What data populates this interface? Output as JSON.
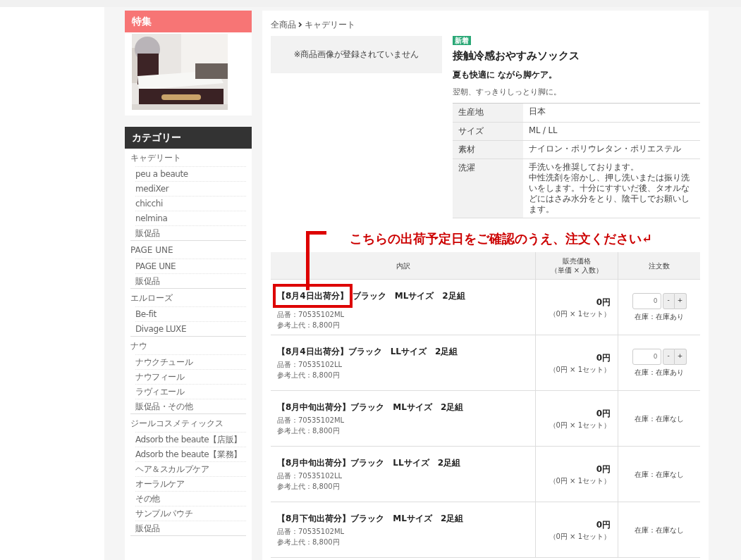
{
  "sidebar": {
    "feature": {
      "title": "特集"
    },
    "categories": {
      "title": "カテゴリー",
      "groups": [
        {
          "label": "キャデリート",
          "children": [
            {
              "label": "peu a beaute"
            },
            {
              "label": "mediXer"
            },
            {
              "label": "chicchi"
            },
            {
              "label": "nelmina"
            },
            {
              "label": "販促品"
            }
          ]
        },
        {
          "label": "PAGE UNE",
          "children": [
            {
              "label": "PAGE UNE"
            },
            {
              "label": "販促品"
            }
          ]
        },
        {
          "label": "エルローズ",
          "children": [
            {
              "label": "Be-fit"
            },
            {
              "label": "Divage LUXE"
            }
          ]
        },
        {
          "label": "ナウ",
          "children": [
            {
              "label": "ナウクチュール"
            },
            {
              "label": "ナウフィール"
            },
            {
              "label": "ラヴィエール"
            },
            {
              "label": "販促品・その他"
            }
          ]
        },
        {
          "label": "ジールコスメティックス",
          "children": [
            {
              "label": "Adsorb the beaute【店販】"
            },
            {
              "label": "Adsorb the beaute【業務】"
            },
            {
              "label": "ヘア＆スカルプケア"
            },
            {
              "label": "オーラルケア"
            },
            {
              "label": "その他"
            },
            {
              "label": "サンプルパウチ"
            },
            {
              "label": "販促品"
            }
          ]
        }
      ]
    }
  },
  "breadcrumb": [
    "全商品",
    "キャデリート"
  ],
  "product": {
    "image_placeholder": "※商品画像が登録されていません",
    "badge": "新着",
    "title": "接触冷感おやすみソックス",
    "catch": "夏も快適に ながら脚ケア。",
    "description": "翌朝、すっきりしっとり脚に。",
    "specs": [
      {
        "label": "生産地",
        "value": "日本"
      },
      {
        "label": "サイズ",
        "value": "ML / LL"
      },
      {
        "label": "素材",
        "value": "ナイロン・ポリウレタン・ポリエステル"
      },
      {
        "label": "洗濯",
        "lines": [
          "手洗いを推奨しております。",
          "中性洗剤を溶かし、押し洗いまたは振り洗いをします。十分にすすいだ後、タオルなどにはさみ水分をとり、陰干しでお願いします。"
        ]
      }
    ]
  },
  "annotation": "こちらの出荷予定日をご確認のうえ、注文ください↵",
  "table": {
    "columns": [
      {
        "label": "内訳"
      },
      {
        "label": "販売価格",
        "sub": "（単価 × 入数）"
      },
      {
        "label": "注文数"
      }
    ],
    "rows": [
      {
        "date": "【8月4日出荷分】",
        "name": "ブラック　MLサイズ　2足組",
        "code": "品番：70535102ML",
        "retail": "参考上代：8,800円",
        "price": "0円",
        "unit": "（0円 × 1セット）",
        "kind": "orderable",
        "qty": "0",
        "minus": "-",
        "plus": "+",
        "stock": "在庫：在庫あり",
        "highlighted": true
      },
      {
        "date": "【8月4日出荷分】",
        "name": "ブラック　LLサイズ　2足組",
        "code": "品番：70535102LL",
        "retail": "参考上代：8,800円",
        "price": "0円",
        "unit": "（0円 × 1セット）",
        "kind": "orderable",
        "qty": "0",
        "minus": "-",
        "plus": "+",
        "stock": "在庫：在庫あり",
        "highlighted": false
      },
      {
        "date": "【8月中旬出荷分】",
        "name": "ブラック　MLサイズ　2足組",
        "code": "品番：70535102ML",
        "retail": "参考上代：8,800円",
        "price": "0円",
        "unit": "（0円 × 1セット）",
        "kind": "out_of_stock",
        "stock": "在庫：在庫なし",
        "highlighted": false
      },
      {
        "date": "【8月中旬出荷分】",
        "name": "ブラック　LLサイズ　2足組",
        "code": "品番：70535102LL",
        "retail": "参考上代：8,800円",
        "price": "0円",
        "unit": "（0円 × 1セット）",
        "kind": "out_of_stock",
        "stock": "在庫：在庫なし",
        "highlighted": false
      },
      {
        "date": "【8月下旬出荷分】",
        "name": "ブラック　MLサイズ　2足組",
        "code": "品番：70535102ML",
        "retail": "参考上代：8,800円",
        "price": "0円",
        "unit": "（0円 × 1セット）",
        "kind": "out_of_stock",
        "stock": "在庫：在庫なし",
        "highlighted": false
      }
    ]
  }
}
